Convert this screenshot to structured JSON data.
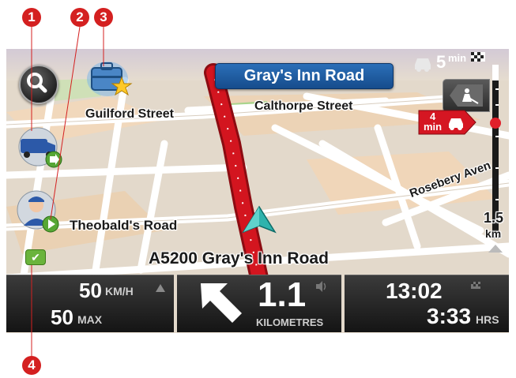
{
  "callouts": [
    "1",
    "2",
    "3",
    "4"
  ],
  "map": {
    "road_banner": "Gray's Inn Road",
    "streets": {
      "guilford": "Guilford Street",
      "calthorpe": "Calthorpe Street",
      "theobalds": "Theobald's Road",
      "rosebery": "Rosebery Aven",
      "current_road": "A5200 Gray's Inn Road"
    },
    "route_color": "#c8121b"
  },
  "traffic": {
    "top_delay_value": "5",
    "top_delay_unit": "min",
    "delay_value": "4",
    "delay_unit": "min"
  },
  "scale": {
    "value": "1.5",
    "unit": "km"
  },
  "bottom_bar": {
    "speed_value": "50",
    "speed_unit": "KM/H",
    "max_value": "50",
    "max_unit": "MAX",
    "distance_value": "1.1",
    "distance_unit": "KILOMETRES",
    "arrival_time": "13:02",
    "remaining_value": "3:33",
    "remaining_unit": "HRS"
  },
  "icons": {
    "search": "search-icon",
    "my_places": "briefcase-star-icon",
    "vehicle": "van-icon",
    "driver": "driver-avatar-icon",
    "roadworks": "roadworks-icon",
    "traffic": "car-icon",
    "checkered_flag": "checkered-flag-icon",
    "volume": "speaker-icon",
    "arrow_left": "turn-left-arrow-icon"
  }
}
